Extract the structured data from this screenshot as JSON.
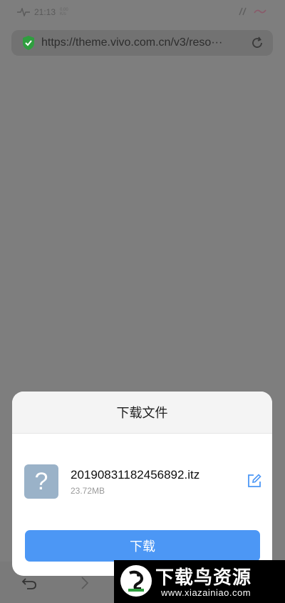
{
  "status_bar": {
    "time": "21:13",
    "speed_value": "0.00",
    "speed_unit": "K/s"
  },
  "browser": {
    "url": "https://theme.vivo.com.cn/v3/reso···"
  },
  "dialog": {
    "title": "下载文件",
    "file_icon_glyph": "?",
    "file_name": "20190831182456892.itz",
    "file_size": "23.72MB",
    "download_label": "下载"
  },
  "watermark": {
    "title": "下载鸟资源",
    "url": "www.xiazainiao.com"
  },
  "colors": {
    "accent": "#4c97f5",
    "shield_green": "#2f9e3f",
    "file_icon_bg": "#9ab2c8"
  },
  "icons": [
    "activity-icon",
    "shield-check-icon",
    "reload-icon",
    "edit-icon",
    "back-icon",
    "forward-icon",
    "signal-icon",
    "battery-icon"
  ]
}
